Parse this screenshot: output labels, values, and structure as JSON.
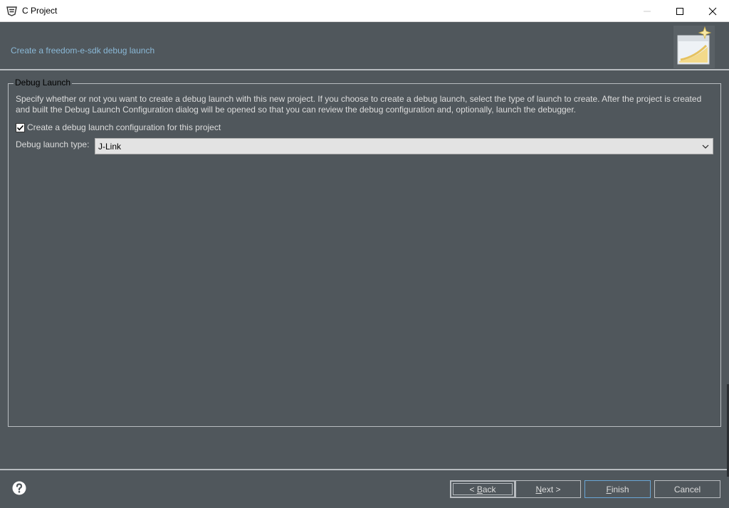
{
  "window": {
    "title": "C Project",
    "icons": {
      "app": "eclipse-app-icon",
      "minimize": "minimize-icon",
      "maximize": "maximize-icon",
      "close": "close-icon"
    }
  },
  "banner": {
    "heading": "Create a freedom-e-sdk debug launch",
    "icon": "wizard-banner-icon"
  },
  "group": {
    "legend": "Debug Launch",
    "description": "Specify whether or not you want to create a debug launch with this new project.  If you choose to create a debug launch, select the type of launch to create.  After the project is created and built the Debug Launch Configuration dialog will be opened so that you can review the debug configuration and, optionally, launch the debugger.",
    "checkbox": {
      "label": "Create a debug launch configuration for this project",
      "checked": true
    },
    "launch_type": {
      "label": "Debug launch type:",
      "selected": "J-Link"
    }
  },
  "footer": {
    "help_icon": "help-icon",
    "buttons": {
      "back": {
        "prefix": "< ",
        "mnemonic": "B",
        "rest": "ack"
      },
      "next": {
        "mnemonic": "N",
        "rest": "ext >"
      },
      "finish": {
        "mnemonic": "F",
        "rest": "inish"
      },
      "cancel": "Cancel"
    }
  },
  "colors": {
    "background": "#50575c",
    "banner_text": "#8ab8d6",
    "default_button_border": "#6aa6d6"
  }
}
